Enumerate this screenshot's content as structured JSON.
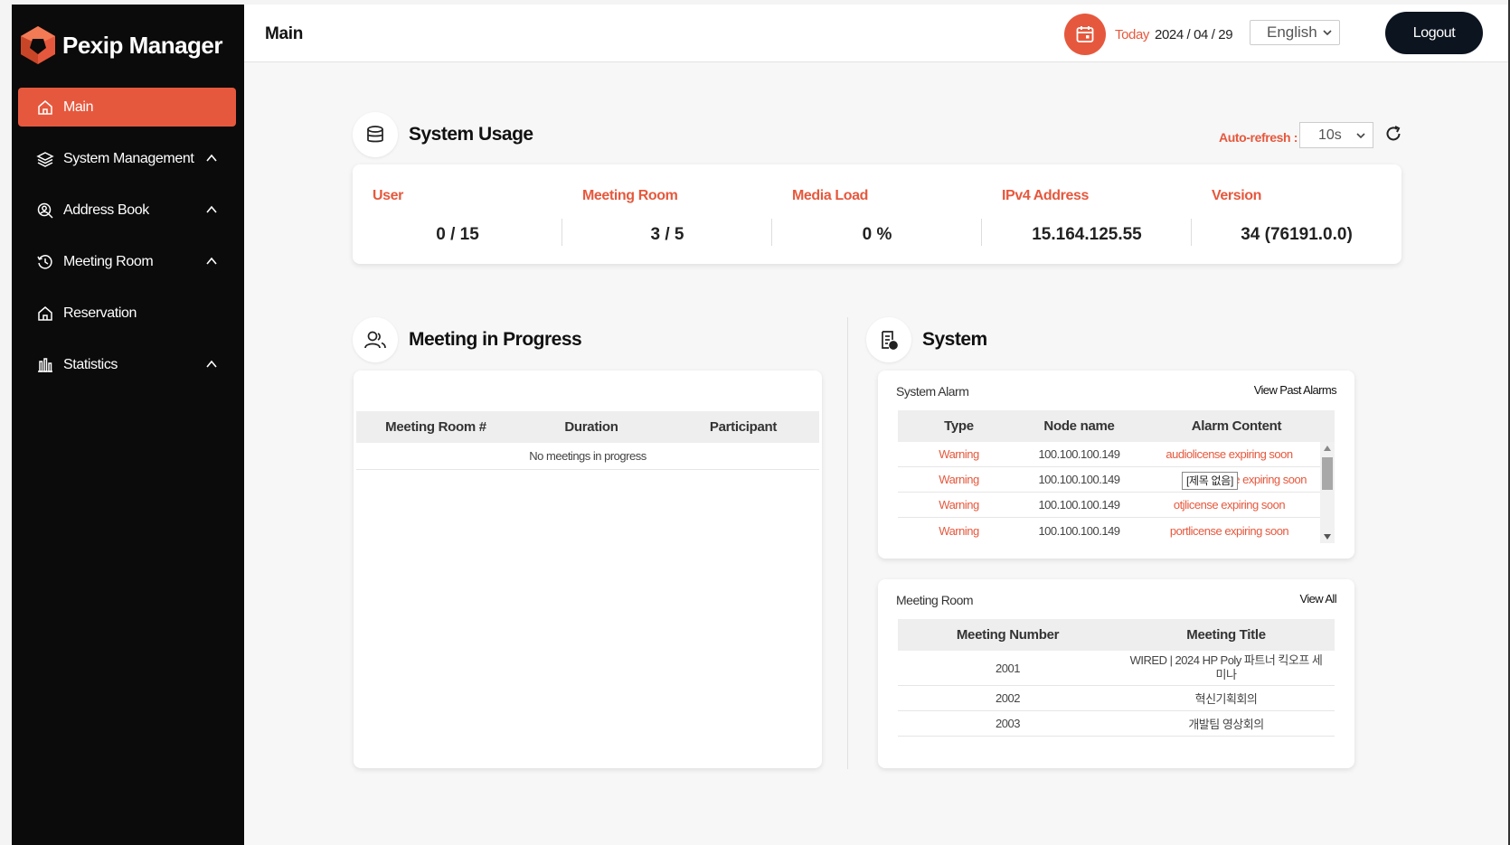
{
  "brand": {
    "name": "Pexip Manager"
  },
  "colors": {
    "accent": "#e6583d",
    "sidebar": "#0b0b0b",
    "logout": "#0c1420"
  },
  "sidebar": {
    "items": [
      {
        "label": "Main",
        "icon": "home-icon",
        "active": true
      },
      {
        "label": "System Management",
        "icon": "layers-icon",
        "expandable": true
      },
      {
        "label": "Address Book",
        "icon": "user-search-icon",
        "expandable": true
      },
      {
        "label": "Meeting Room",
        "icon": "history-icon",
        "expandable": true
      },
      {
        "label": "Reservation",
        "icon": "home-icon"
      },
      {
        "label": "Statistics",
        "icon": "bar-chart-icon",
        "expandable": true
      }
    ]
  },
  "header": {
    "title": "Main",
    "today_label": "Today",
    "today_date": "2024 / 04 / 29",
    "language": "English",
    "logout_label": "Logout"
  },
  "usage": {
    "title": "System Usage",
    "auto_refresh_label": "Auto-refresh :",
    "auto_refresh_value": "10s",
    "metrics": [
      {
        "label": "User",
        "value": "0 / 15"
      },
      {
        "label": "Meeting Room",
        "value": "3 / 5"
      },
      {
        "label": "Media Load",
        "value": "0 %"
      },
      {
        "label": "IPv4 Address",
        "value": "15.164.125.55"
      },
      {
        "label": "Version",
        "value": "34 (76191.0.0)"
      }
    ]
  },
  "meetings_in_progress": {
    "title": "Meeting in Progress",
    "columns": [
      "Meeting Room #",
      "Duration",
      "Participant"
    ],
    "empty_text": "No meetings in progress"
  },
  "system": {
    "title": "System",
    "alarm": {
      "title": "System Alarm",
      "link": "View Past Alarms",
      "columns": [
        "Type",
        "Node name",
        "Alarm Content"
      ],
      "rows": [
        {
          "type": "Warning",
          "node": "100.100.100.149",
          "content": "audiolicense expiring soon"
        },
        {
          "type": "Warning",
          "node": "100.100.100.149",
          "content": "license expiring soon"
        },
        {
          "type": "Warning",
          "node": "100.100.100.149",
          "content": "otjlicense expiring soon"
        },
        {
          "type": "Warning",
          "node": "100.100.100.149",
          "content": "portlicense expiring soon"
        }
      ],
      "tooltip": "[제목 없음]"
    },
    "rooms": {
      "title": "Meeting Room",
      "link": "View All",
      "columns": [
        "Meeting Number",
        "Meeting Title"
      ],
      "rows": [
        {
          "number": "2001",
          "title": "WIRED  |  2024 HP Poly 파트너 킥오프 세미나"
        },
        {
          "number": "2002",
          "title": "혁신기획회의"
        },
        {
          "number": "2003",
          "title": "개발팀 영상회의"
        }
      ]
    }
  }
}
